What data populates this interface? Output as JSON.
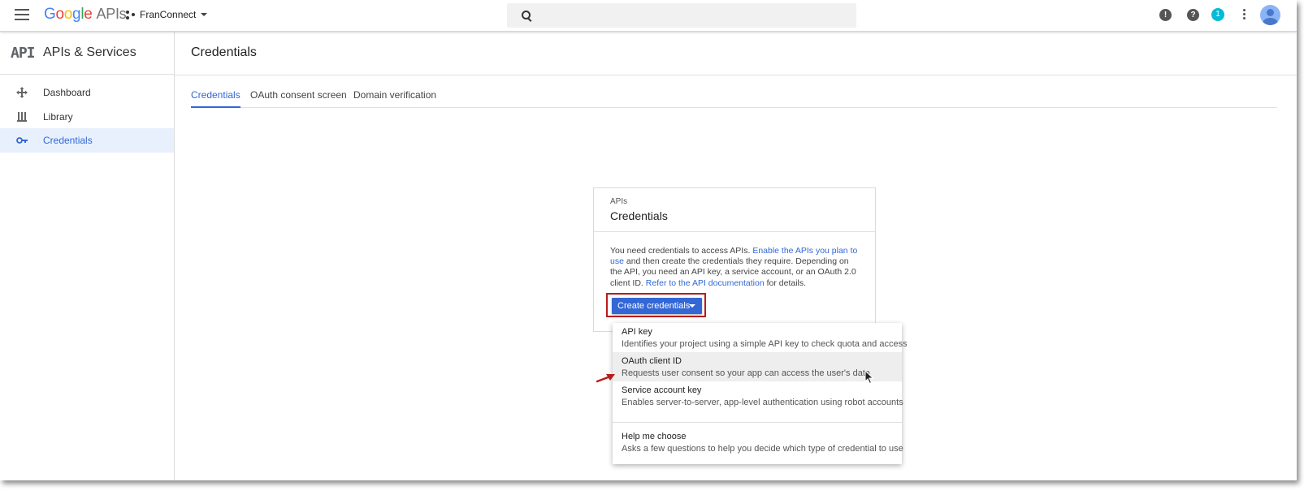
{
  "topbar": {
    "logo_letters": [
      "G",
      "o",
      "o",
      "g",
      "l",
      "e"
    ],
    "logo_suffix": "APIs",
    "project_name": "FranConnect",
    "search_placeholder": "",
    "notification_count": "1"
  },
  "sidebar": {
    "title": "APIs & Services",
    "api_mark": "API",
    "items": [
      {
        "label": "Dashboard",
        "icon": "dashboard-icon"
      },
      {
        "label": "Library",
        "icon": "library-icon"
      },
      {
        "label": "Credentials",
        "icon": "key-icon",
        "active": true
      }
    ]
  },
  "page": {
    "title": "Credentials",
    "tabs": [
      {
        "label": "Credentials",
        "active": true
      },
      {
        "label": "OAuth consent screen"
      },
      {
        "label": "Domain verification"
      }
    ]
  },
  "card": {
    "subtitle": "APIs",
    "title": "Credentials",
    "desc_1": "You need credentials to access APIs. ",
    "desc_link_1": "Enable the APIs you plan to use",
    "desc_2": " and then create the credentials they require. Depending on the API, you need an API key, a service account, or an OAuth 2.0 client ID. ",
    "desc_link_2": "Refer to the API documentation",
    "desc_3": " for details.",
    "button_label": "Create credentials"
  },
  "menu": {
    "items": [
      {
        "title": "API key",
        "desc": "Identifies your project using a simple API key to check quota and access"
      },
      {
        "title": "OAuth client ID",
        "desc": "Requests user consent so your app can access the user's data",
        "hover": true
      },
      {
        "title": "Service account key",
        "desc": "Enables server-to-server, app-level authentication using robot accounts"
      },
      {
        "title": "Help me choose",
        "desc": "Asks a few questions to help you decide which type of credential to use"
      }
    ]
  },
  "colors": {
    "accent": "#3367d6",
    "highlight_border": "#b91c1c",
    "active_nav_bg": "#e8f0fe",
    "badge": "#00bcd4"
  }
}
